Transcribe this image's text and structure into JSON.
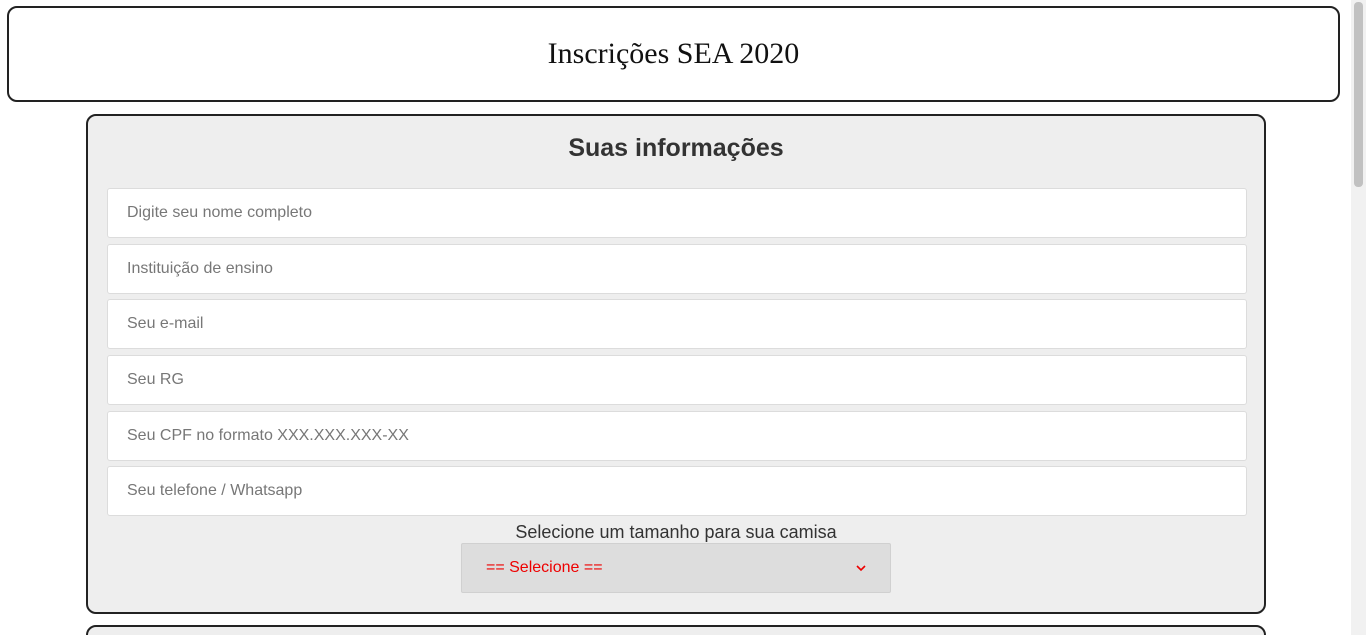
{
  "header": {
    "title": "Inscrições SEA 2020"
  },
  "form": {
    "section_title": "Suas informações",
    "fields": [
      {
        "name": "full-name-field",
        "placeholder": "Digite seu nome completo"
      },
      {
        "name": "institution-field",
        "placeholder": "Instituição de ensino"
      },
      {
        "name": "email-field",
        "placeholder": "Seu e-mail"
      },
      {
        "name": "rg-field",
        "placeholder": "Seu RG"
      },
      {
        "name": "cpf-field",
        "placeholder": "Seu CPF no formato XXX.XXX.XXX-XX"
      },
      {
        "name": "phone-field",
        "placeholder": "Seu telefone / Whatsapp"
      }
    ],
    "shirt_label": "Selecione um tamanho para sua camisa",
    "shirt_select": {
      "selected": "== Selecione ==",
      "color": "#ee0000"
    }
  },
  "icons": {
    "select_arrow": "chevron-down-icon"
  }
}
